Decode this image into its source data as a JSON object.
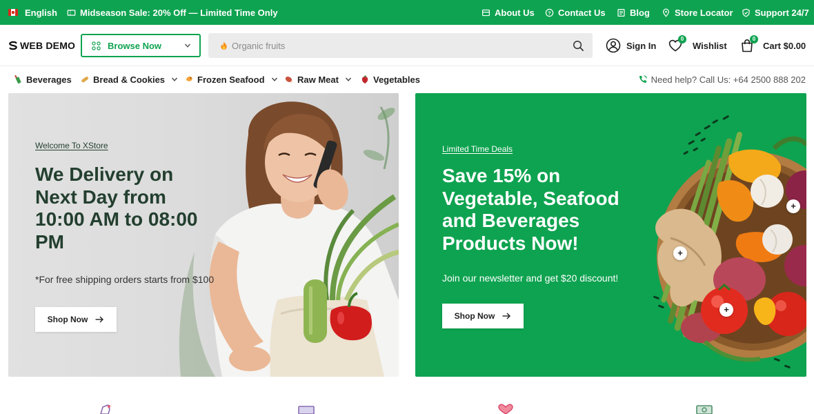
{
  "topbar": {
    "language": "English",
    "promo": "Midseason Sale: 20% Off — Limited Time Only",
    "links": [
      "About Us",
      "Contact Us",
      "Blog",
      "Store Locator",
      "Support 24/7"
    ]
  },
  "header": {
    "logo": "WEB DEMO",
    "browse_label": "Browse Now",
    "search_placeholder": "Organic fruits",
    "sign_in": "Sign In",
    "wishlist": "Wishlist",
    "wishlist_count": "0",
    "cart": "Cart $0.00",
    "cart_count": "0"
  },
  "nav": {
    "items": [
      {
        "label": "Beverages",
        "icon": "beverages-icon"
      },
      {
        "label": "Bread & Cookies",
        "icon": "bread-icon"
      },
      {
        "label": "Frozen Seafood",
        "icon": "seafood-icon"
      },
      {
        "label": "Raw Meat",
        "icon": "meat-icon"
      },
      {
        "label": "Vegetables",
        "icon": "vegetables-icon"
      }
    ],
    "help": "Need help? Call Us: +64 2500 888 202"
  },
  "banner_left": {
    "kicker": "Welcome To XStore",
    "title": [
      "We Delivery on",
      "Next Day from",
      "10:00 AM to 08:00",
      "PM"
    ],
    "subtitle": "*For free shipping orders starts from $100",
    "button": "Shop Now"
  },
  "banner_right": {
    "kicker": "Limited Time Deals",
    "title": [
      "Save 15% on",
      "Vegetable, Seafood",
      "and Beverages",
      "Products Now!"
    ],
    "subtitle": "Join our newsletter and get $20 discount!",
    "button": "Shop Now",
    "hotspot": "+"
  },
  "colors": {
    "brand": "#0ea350",
    "title_dark": "#233f2f",
    "text": "#1e1e1e"
  }
}
